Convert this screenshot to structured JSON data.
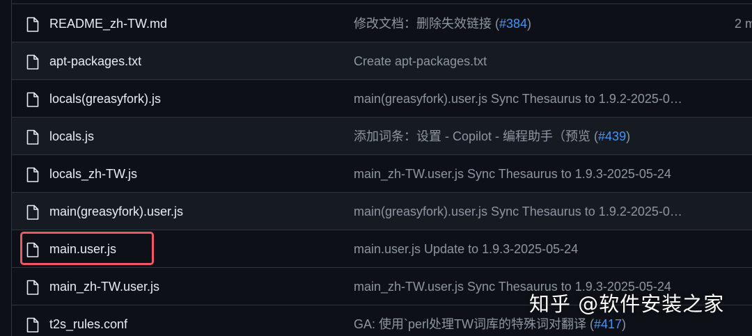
{
  "files": [
    {
      "name": "README_zh-TW.md",
      "msg_prefix": "修改文档：删除失效链接 (",
      "issue": "#384",
      "msg_suffix": ")",
      "time": "2 m"
    },
    {
      "name": "apt-packages.txt",
      "msg_prefix": "Create apt-packages.txt",
      "issue": "",
      "msg_suffix": "",
      "time": ""
    },
    {
      "name": "locals(greasyfork).js",
      "msg_prefix": "main(greasyfork).user.js Sync Thesaurus to 1.9.2-2025-0…",
      "issue": "",
      "msg_suffix": "",
      "time": ""
    },
    {
      "name": "locals.js",
      "msg_prefix": "添加词条：设置 - Copilot - 编程助手（预览 (",
      "issue": "#439",
      "msg_suffix": ")",
      "time": ""
    },
    {
      "name": "locals_zh-TW.js",
      "msg_prefix": "main_zh-TW.user.js Sync Thesaurus to 1.9.3-2025-05-24",
      "issue": "",
      "msg_suffix": "",
      "time": ""
    },
    {
      "name": "main(greasyfork).user.js",
      "msg_prefix": "main(greasyfork).user.js Sync Thesaurus to 1.9.2-2025-0…",
      "issue": "",
      "msg_suffix": "",
      "time": ""
    },
    {
      "name": "main.user.js",
      "msg_prefix": "main.user.js Update to 1.9.3-2025-05-24",
      "issue": "",
      "msg_suffix": "",
      "time": ""
    },
    {
      "name": "main_zh-TW.user.js",
      "msg_prefix": "main_zh-TW.user.js Sync Thesaurus to 1.9.3-2025-05-24",
      "issue": "",
      "msg_suffix": "",
      "time": ""
    },
    {
      "name": "t2s_rules.conf",
      "msg_prefix": "GA: 使用`perl处理TW词库的特殊词对翻译 (",
      "issue": "#417",
      "msg_suffix": ")",
      "time": ""
    }
  ],
  "watermark": "知乎 @软件安装之家",
  "colors": {
    "background": "#0d1117",
    "row_alt": "#161b22",
    "border": "#30363d",
    "text": "#e6edf3",
    "muted": "#8d96a0",
    "link": "#4493f8",
    "highlight": "#f0566b"
  },
  "icons": {
    "file": "file-icon"
  }
}
